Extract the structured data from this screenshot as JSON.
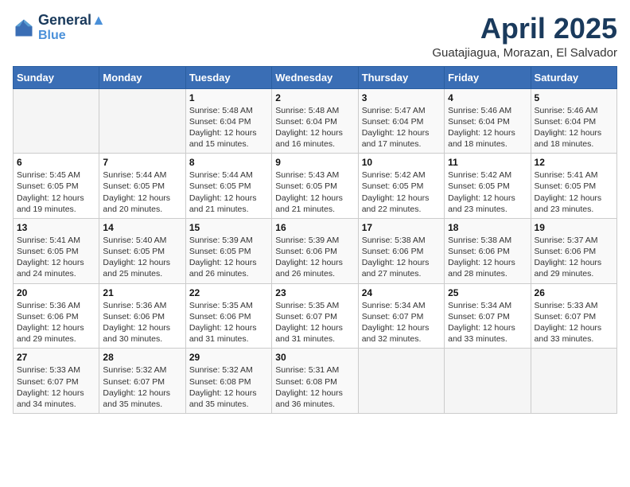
{
  "header": {
    "logo_line1": "General",
    "logo_line2": "Blue",
    "month": "April 2025",
    "location": "Guatajiagua, Morazan, El Salvador"
  },
  "weekdays": [
    "Sunday",
    "Monday",
    "Tuesday",
    "Wednesday",
    "Thursday",
    "Friday",
    "Saturday"
  ],
  "weeks": [
    [
      {
        "day": "",
        "info": ""
      },
      {
        "day": "",
        "info": ""
      },
      {
        "day": "1",
        "info": "Sunrise: 5:48 AM\nSunset: 6:04 PM\nDaylight: 12 hours and 15 minutes."
      },
      {
        "day": "2",
        "info": "Sunrise: 5:48 AM\nSunset: 6:04 PM\nDaylight: 12 hours and 16 minutes."
      },
      {
        "day": "3",
        "info": "Sunrise: 5:47 AM\nSunset: 6:04 PM\nDaylight: 12 hours and 17 minutes."
      },
      {
        "day": "4",
        "info": "Sunrise: 5:46 AM\nSunset: 6:04 PM\nDaylight: 12 hours and 18 minutes."
      },
      {
        "day": "5",
        "info": "Sunrise: 5:46 AM\nSunset: 6:04 PM\nDaylight: 12 hours and 18 minutes."
      }
    ],
    [
      {
        "day": "6",
        "info": "Sunrise: 5:45 AM\nSunset: 6:05 PM\nDaylight: 12 hours and 19 minutes."
      },
      {
        "day": "7",
        "info": "Sunrise: 5:44 AM\nSunset: 6:05 PM\nDaylight: 12 hours and 20 minutes."
      },
      {
        "day": "8",
        "info": "Sunrise: 5:44 AM\nSunset: 6:05 PM\nDaylight: 12 hours and 21 minutes."
      },
      {
        "day": "9",
        "info": "Sunrise: 5:43 AM\nSunset: 6:05 PM\nDaylight: 12 hours and 21 minutes."
      },
      {
        "day": "10",
        "info": "Sunrise: 5:42 AM\nSunset: 6:05 PM\nDaylight: 12 hours and 22 minutes."
      },
      {
        "day": "11",
        "info": "Sunrise: 5:42 AM\nSunset: 6:05 PM\nDaylight: 12 hours and 23 minutes."
      },
      {
        "day": "12",
        "info": "Sunrise: 5:41 AM\nSunset: 6:05 PM\nDaylight: 12 hours and 23 minutes."
      }
    ],
    [
      {
        "day": "13",
        "info": "Sunrise: 5:41 AM\nSunset: 6:05 PM\nDaylight: 12 hours and 24 minutes."
      },
      {
        "day": "14",
        "info": "Sunrise: 5:40 AM\nSunset: 6:05 PM\nDaylight: 12 hours and 25 minutes."
      },
      {
        "day": "15",
        "info": "Sunrise: 5:39 AM\nSunset: 6:05 PM\nDaylight: 12 hours and 26 minutes."
      },
      {
        "day": "16",
        "info": "Sunrise: 5:39 AM\nSunset: 6:06 PM\nDaylight: 12 hours and 26 minutes."
      },
      {
        "day": "17",
        "info": "Sunrise: 5:38 AM\nSunset: 6:06 PM\nDaylight: 12 hours and 27 minutes."
      },
      {
        "day": "18",
        "info": "Sunrise: 5:38 AM\nSunset: 6:06 PM\nDaylight: 12 hours and 28 minutes."
      },
      {
        "day": "19",
        "info": "Sunrise: 5:37 AM\nSunset: 6:06 PM\nDaylight: 12 hours and 29 minutes."
      }
    ],
    [
      {
        "day": "20",
        "info": "Sunrise: 5:36 AM\nSunset: 6:06 PM\nDaylight: 12 hours and 29 minutes."
      },
      {
        "day": "21",
        "info": "Sunrise: 5:36 AM\nSunset: 6:06 PM\nDaylight: 12 hours and 30 minutes."
      },
      {
        "day": "22",
        "info": "Sunrise: 5:35 AM\nSunset: 6:06 PM\nDaylight: 12 hours and 31 minutes."
      },
      {
        "day": "23",
        "info": "Sunrise: 5:35 AM\nSunset: 6:07 PM\nDaylight: 12 hours and 31 minutes."
      },
      {
        "day": "24",
        "info": "Sunrise: 5:34 AM\nSunset: 6:07 PM\nDaylight: 12 hours and 32 minutes."
      },
      {
        "day": "25",
        "info": "Sunrise: 5:34 AM\nSunset: 6:07 PM\nDaylight: 12 hours and 33 minutes."
      },
      {
        "day": "26",
        "info": "Sunrise: 5:33 AM\nSunset: 6:07 PM\nDaylight: 12 hours and 33 minutes."
      }
    ],
    [
      {
        "day": "27",
        "info": "Sunrise: 5:33 AM\nSunset: 6:07 PM\nDaylight: 12 hours and 34 minutes."
      },
      {
        "day": "28",
        "info": "Sunrise: 5:32 AM\nSunset: 6:07 PM\nDaylight: 12 hours and 35 minutes."
      },
      {
        "day": "29",
        "info": "Sunrise: 5:32 AM\nSunset: 6:08 PM\nDaylight: 12 hours and 35 minutes."
      },
      {
        "day": "30",
        "info": "Sunrise: 5:31 AM\nSunset: 6:08 PM\nDaylight: 12 hours and 36 minutes."
      },
      {
        "day": "",
        "info": ""
      },
      {
        "day": "",
        "info": ""
      },
      {
        "day": "",
        "info": ""
      }
    ]
  ]
}
